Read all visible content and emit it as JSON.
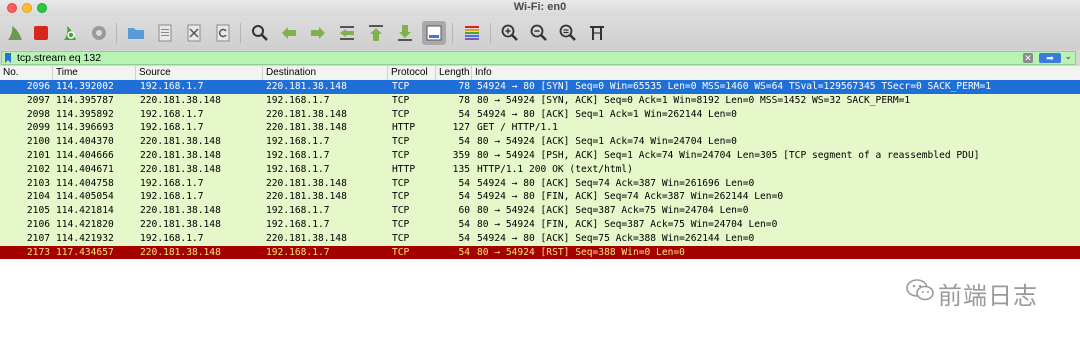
{
  "window": {
    "title": "Wi-Fi: en0"
  },
  "filter": {
    "value": "tcp.stream eq 132"
  },
  "columns": [
    "No.",
    "Time",
    "Source",
    "Destination",
    "Protocol",
    "Length",
    "Info"
  ],
  "colors": {
    "selected_bg": "#1f6fd8",
    "tcp_bg": "#e6f7c9",
    "http_bg": "#e6f7c9",
    "rst_bg": "#a40000",
    "rst_fg": "#ffe27a"
  },
  "packets": [
    {
      "no": "2096",
      "time": "114.392002",
      "src": "192.168.1.7",
      "dst": "220.181.38.148",
      "proto": "TCP",
      "len": "78",
      "info": "54924 → 80 [SYN] Seq=0 Win=65535 Len=0 MSS=1460 WS=64 TSval=129567345 TSecr=0 SACK_PERM=1",
      "style": "selected"
    },
    {
      "no": "2097",
      "time": "114.395787",
      "src": "220.181.38.148",
      "dst": "192.168.1.7",
      "proto": "TCP",
      "len": "78",
      "info": "80 → 54924 [SYN, ACK] Seq=0 Ack=1 Win=8192 Len=0 MSS=1452 WS=32 SACK_PERM=1",
      "style": "normal"
    },
    {
      "no": "2098",
      "time": "114.395892",
      "src": "192.168.1.7",
      "dst": "220.181.38.148",
      "proto": "TCP",
      "len": "54",
      "info": "54924 → 80 [ACK] Seq=1 Ack=1 Win=262144 Len=0",
      "style": "normal"
    },
    {
      "no": "2099",
      "time": "114.396693",
      "src": "192.168.1.7",
      "dst": "220.181.38.148",
      "proto": "HTTP",
      "len": "127",
      "info": "GET / HTTP/1.1",
      "style": "normal"
    },
    {
      "no": "2100",
      "time": "114.404370",
      "src": "220.181.38.148",
      "dst": "192.168.1.7",
      "proto": "TCP",
      "len": "54",
      "info": "80 → 54924 [ACK] Seq=1 Ack=74 Win=24704 Len=0",
      "style": "normal"
    },
    {
      "no": "2101",
      "time": "114.404666",
      "src": "220.181.38.148",
      "dst": "192.168.1.7",
      "proto": "TCP",
      "len": "359",
      "info": "80 → 54924 [PSH, ACK] Seq=1 Ack=74 Win=24704 Len=305 [TCP segment of a reassembled PDU]",
      "style": "normal"
    },
    {
      "no": "2102",
      "time": "114.404671",
      "src": "220.181.38.148",
      "dst": "192.168.1.7",
      "proto": "HTTP",
      "len": "135",
      "info": "HTTP/1.1 200 OK  (text/html)",
      "style": "normal"
    },
    {
      "no": "2103",
      "time": "114.404758",
      "src": "192.168.1.7",
      "dst": "220.181.38.148",
      "proto": "TCP",
      "len": "54",
      "info": "54924 → 80 [ACK] Seq=74 Ack=387 Win=261696 Len=0",
      "style": "normal"
    },
    {
      "no": "2104",
      "time": "114.405054",
      "src": "192.168.1.7",
      "dst": "220.181.38.148",
      "proto": "TCP",
      "len": "54",
      "info": "54924 → 80 [FIN, ACK] Seq=74 Ack=387 Win=262144 Len=0",
      "style": "normal"
    },
    {
      "no": "2105",
      "time": "114.421814",
      "src": "220.181.38.148",
      "dst": "192.168.1.7",
      "proto": "TCP",
      "len": "60",
      "info": "80 → 54924 [ACK] Seq=387 Ack=75 Win=24704 Len=0",
      "style": "normal"
    },
    {
      "no": "2106",
      "time": "114.421820",
      "src": "220.181.38.148",
      "dst": "192.168.1.7",
      "proto": "TCP",
      "len": "54",
      "info": "80 → 54924 [FIN, ACK] Seq=387 Ack=75 Win=24704 Len=0",
      "style": "normal"
    },
    {
      "no": "2107",
      "time": "114.421932",
      "src": "192.168.1.7",
      "dst": "220.181.38.148",
      "proto": "TCP",
      "len": "54",
      "info": "54924 → 80 [ACK] Seq=75 Ack=388 Win=262144 Len=0",
      "style": "normal"
    },
    {
      "no": "2173",
      "time": "117.434657",
      "src": "220.181.38.148",
      "dst": "192.168.1.7",
      "proto": "TCP",
      "len": "54",
      "info": "80 → 54924 [RST] Seq=388 Win=0 Len=0",
      "style": "rst"
    }
  ],
  "toolbar_icons": [
    "shark-fin-start-icon",
    "stop-capture-icon",
    "restart-capture-icon",
    "capture-options-icon",
    "open-file-icon",
    "save-file-icon",
    "close-file-icon",
    "reload-file-icon",
    "find-packet-icon",
    "go-back-icon",
    "go-forward-icon",
    "go-to-packet-icon",
    "go-first-packet-icon",
    "go-last-packet-icon",
    "auto-scroll-icon",
    "colorize-icon",
    "zoom-in-icon",
    "zoom-out-icon",
    "zoom-normal-icon",
    "resize-columns-icon"
  ],
  "watermark": {
    "text": "前端日志"
  }
}
